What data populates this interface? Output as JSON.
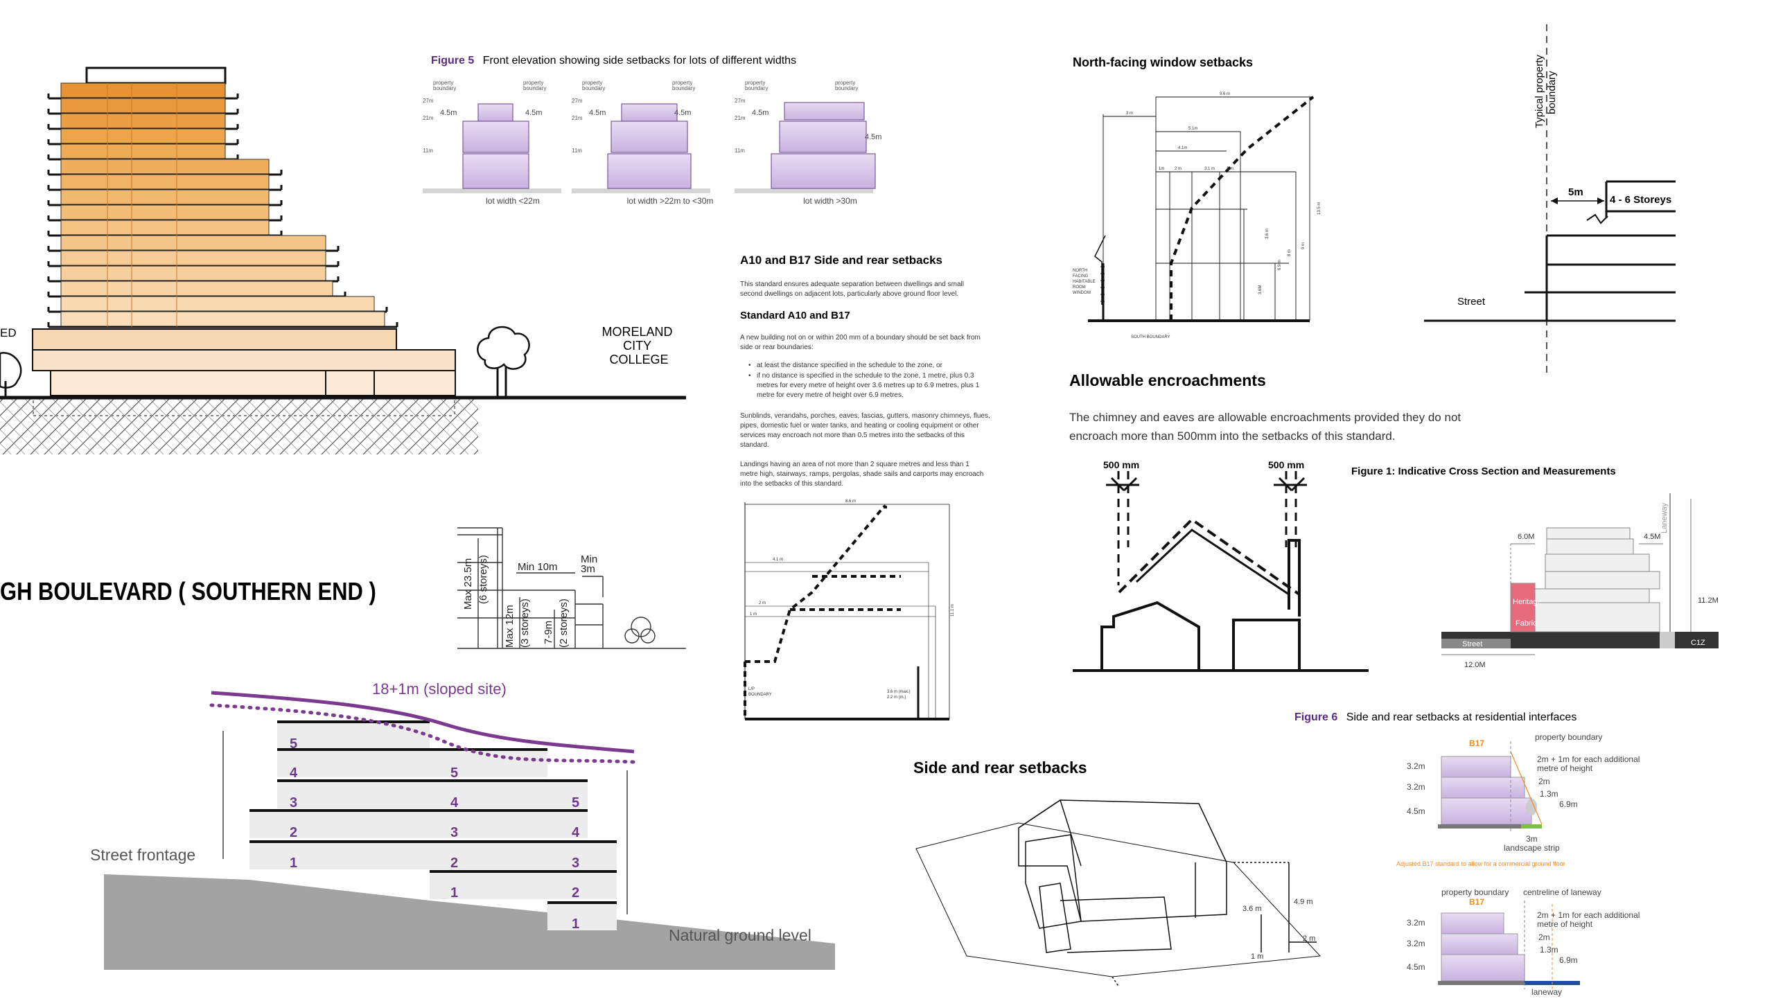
{
  "tower": {
    "label_left": "ED",
    "label_college": [
      "MORELAND",
      "CITY",
      "COLLEGE"
    ]
  },
  "boulevard": {
    "title": "GH BOULEVARD ( SOUTHERN END )"
  },
  "height_section": {
    "labels": [
      "Min 10m",
      "Min",
      "3m",
      "Max 23.5m",
      "(6 storeys)",
      "Max 12m",
      "(3 storeys)",
      "7-9m",
      "(2 storeys)"
    ]
  },
  "sloped": {
    "title": "18+1m (sloped site)",
    "street_frontage": "Street frontage",
    "natural_ground": "Natural ground level",
    "col1": [
      "5",
      "4",
      "3",
      "2",
      "1"
    ],
    "col2": [
      "5",
      "4",
      "3",
      "2",
      "1"
    ],
    "col3": [
      "5",
      "4",
      "3",
      "2",
      "1"
    ]
  },
  "figure5": {
    "fig": "Figure 5",
    "title": "Front elevation showing side setbacks for lots of different widths",
    "boundary": [
      "property",
      "boundary"
    ],
    "heights": [
      "27m",
      "21m",
      "11m"
    ],
    "setback": "4.5m",
    "captions": [
      "lot width <22m",
      "lot width >22m to <30m",
      "lot width >30m"
    ]
  },
  "a10": {
    "heading": "A10 and B17 Side and rear setbacks",
    "intro": [
      "This standard ensures adequate separation between dwellings and small",
      "second dwellings on adjacent lots, particularly above ground floor level."
    ],
    "subheading": "Standard A10 and B17",
    "para1": [
      "A new building not on or within 200 mm of a boundary should be set back from",
      "side or rear boundaries:"
    ],
    "bullets": [
      [
        "at least the distance specified in the schedule to the zone, or"
      ],
      [
        "if no distance is specified in the schedule to the zone, 1 metre, plus 0.3",
        "metres for every metre of height over 3.6 metres up to 6.9 metres, plus 1",
        "metre for every metre of height over 6.9 metres."
      ]
    ],
    "para2": [
      "Sunblinds, verandahs, porches, eaves, fascias, gutters, masonry chimneys, flues,",
      "pipes, domestic fuel or water tanks, and heating or cooling equipment or other",
      "services may encroach not more than 0.5 metres into the setbacks of this",
      "standard."
    ],
    "para3": [
      "Landings having an area of not more than 2 square metres and less than 1",
      "metre high, stairways, ramps, pergolas, shade sails and carports may encroach",
      "into the setbacks of this standard."
    ],
    "diagram": {
      "top": "8.6 m",
      "d1": "4.1 m",
      "d2": "2 m",
      "d3": "1 m",
      "h": "11.1 m",
      "boundary": [
        "L/P",
        "BOUNDARY"
      ],
      "note": [
        "3.6 m (max.)",
        "2.2 m (m.)"
      ]
    }
  },
  "north": {
    "title": "North-facing window setbacks",
    "dims": [
      "9.6 m",
      "3 m",
      "5.1m",
      "4.1m",
      "1m",
      "2 m",
      "3.1 m",
      "1 m"
    ],
    "heights": [
      "13.5 m",
      "9 m",
      "8 m",
      "6.9 m",
      "3.6 m",
      "3.6M"
    ],
    "window": [
      "NORTH",
      "FACING",
      "HABITABLE",
      "ROOM",
      "WINDOW"
    ],
    "south": "SOUTH BOUNDARY"
  },
  "boundary_section": {
    "boundary_label": [
      "Typical property",
      "boundary"
    ],
    "dim": "5m",
    "storeys": "4 - 6 Storeys",
    "street": "Street"
  },
  "encroach": {
    "title": "Allowable encroachments",
    "text": [
      "The chimney and eaves are allowable encroachments provided they do not",
      "encroach more than 500mm into the setbacks of this standard."
    ],
    "left": "500 mm",
    "right": "500 mm"
  },
  "figure1": {
    "title": "Figure 1: Indicative Cross Section and Measurements",
    "dim_left": "6.0M",
    "dim_right": "4.5M",
    "height": "11.2M",
    "heritage": "Heritage",
    "fabric": "Fabric",
    "street": "Street",
    "width": "12.0M",
    "zone": "C1Z",
    "laneway": "Laneway"
  },
  "figure6": {
    "fig": "Figure 6",
    "title": "Side and rear setbacks at residential interfaces",
    "b17": "B17",
    "boundary": "property boundary",
    "centreline": "centreline of laneway",
    "rule": [
      "2m + 1m for each additional",
      "metre of height"
    ],
    "d2m": "2m",
    "d13": "1.3m",
    "d69": "6.9m",
    "heights": [
      "3.2m",
      "3.2m",
      "4.5m"
    ],
    "strip": [
      "3m",
      "landscape strip"
    ],
    "note": "Adjusted B17 standard to allow for a commercial ground floor",
    "laneway": "laneway"
  },
  "side_rear": {
    "title": "Side and rear setbacks",
    "dims": [
      "4.9 m",
      "3.6 m",
      "2 m",
      "1 m"
    ]
  }
}
